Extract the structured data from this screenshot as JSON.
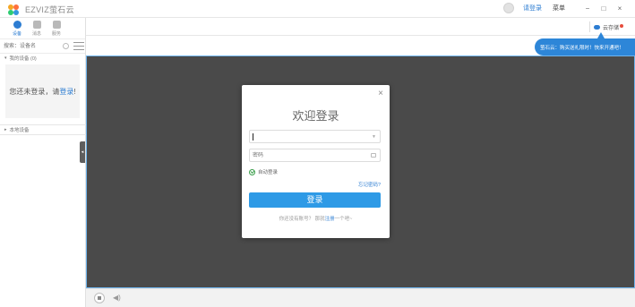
{
  "titlebar": {
    "logo_text": "EZVIZ萤石云",
    "login_link": "请登录",
    "menu": "菜单",
    "minimize": "−",
    "maximize": "□",
    "close": "×"
  },
  "sidebar": {
    "tabs": [
      {
        "label": "设备",
        "icon": "camera-icon",
        "active": true
      },
      {
        "label": "消息",
        "icon": "message-icon",
        "active": false
      },
      {
        "label": "服务",
        "icon": "grid-icon",
        "active": false
      }
    ],
    "search_placeholder": "搜索：设备名",
    "my_devices": "我的设备 (0)",
    "empty_text": "您还未登录，请",
    "empty_link": "登录",
    "empty_end": "!",
    "local_devices": "本地设备"
  },
  "toolbar": {
    "cloud_label": "云存储"
  },
  "promo": {
    "text": "萤石云：购买送礼限时！快来开通吧！"
  },
  "login": {
    "title": "欢迎登录",
    "username_value": "",
    "password_placeholder": "密码",
    "auto_login": "自动登录",
    "forgot": "忘记密码?",
    "submit": "登录",
    "register_prefix": "你还没有账号？ 那就",
    "register_link": "注册",
    "register_suffix": "一个吧~"
  },
  "colors": {
    "accent": "#2d7dd2",
    "button": "#2e9ae6",
    "video_bg": "#4a4a4a"
  }
}
